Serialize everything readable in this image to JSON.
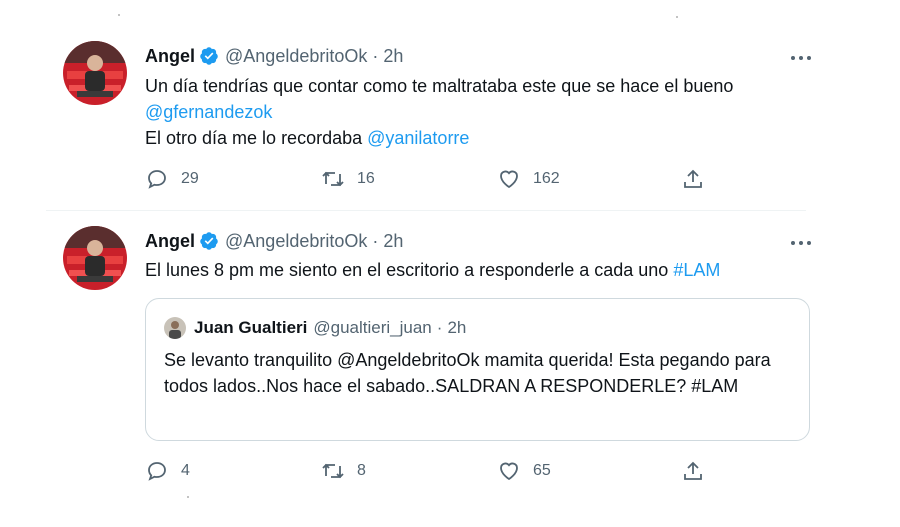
{
  "tweets": [
    {
      "name": "Angel",
      "handle": "@AngeldebritoOk",
      "separator": "·",
      "time": "2h",
      "lines": [
        {
          "text": "Un día tendrías que contar como te maltrataba este que se hace el bueno",
          "mention": ""
        },
        {
          "text": "",
          "mention": "@gfernandezok"
        },
        {
          "text": "El otro día me lo recordaba ",
          "mention": "@yanilatorre"
        }
      ],
      "replies": "29",
      "retweets": "16",
      "likes": "162"
    },
    {
      "name": "Angel",
      "handle": "@AngeldebritoOk",
      "separator": "·",
      "time": "2h",
      "text": "El lunes 8 pm me siento en el escritorio a responderle a cada uno ",
      "hashtag": "#LAM",
      "quote": {
        "name": "Juan Gualtieri",
        "handle": "@gualtieri_juan",
        "separator": "·",
        "time": "2h",
        "text": "Se levanto tranquilito @AngeldebritoOk mamita querida! Esta pegando para todos lados..Nos hace el sabado..SALDRAN A RESPONDERLE? #LAM"
      },
      "replies": "4",
      "retweets": "8",
      "likes": "65"
    }
  ],
  "icons": {
    "verified": "verified-badge-icon",
    "more": "more-options-icon",
    "reply": "reply-icon",
    "retweet": "retweet-icon",
    "like": "like-icon",
    "share": "share-icon"
  },
  "colors": {
    "text": "#0f1419",
    "secondary": "#536471",
    "link": "#1d9bf0",
    "verified": "#1d9bf0",
    "border": "#cfd9de"
  }
}
